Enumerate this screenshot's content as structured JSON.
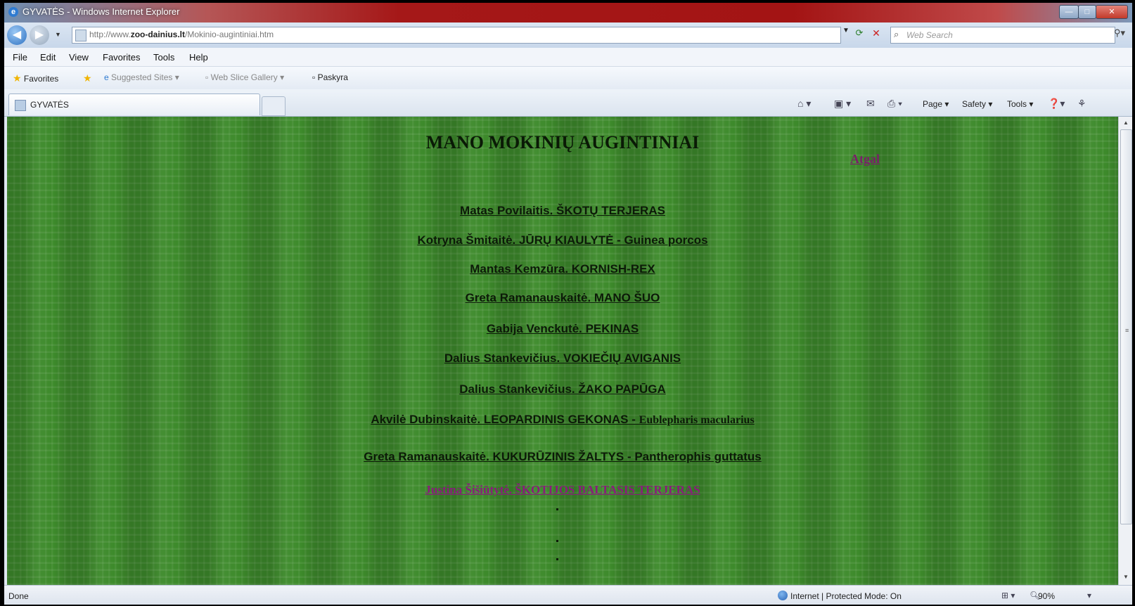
{
  "window": {
    "title": "GYVATĖS - Windows Internet Explorer",
    "minimize": "—",
    "maximize": "□",
    "close": "✕"
  },
  "address": {
    "url_prefix": "http://www.",
    "url_domain": "zoo-dainius.lt",
    "url_path": "/Mokinio-augintiniai.htm",
    "search_placeholder": "Web Search"
  },
  "menu": [
    "File",
    "Edit",
    "View",
    "Favorites",
    "Tools",
    "Help"
  ],
  "favorites": {
    "favorites_label": "Favorites",
    "suggested_sites": "Suggested Sites ▾",
    "web_slice_gallery": "Web Slice Gallery ▾",
    "paskyra": "Paskyra"
  },
  "tab": {
    "label": "GYVATĖS"
  },
  "commands": {
    "page": "Page ▾",
    "safety": "Safety ▾",
    "tools": "Tools ▾"
  },
  "content": {
    "title": "MANO MOKINIŲ AUGINTINIAI",
    "back_link": "Atgal",
    "links": [
      {
        "text": "Matas Povilaitis. ŠKOTŲ TERJERAS",
        "extra": ""
      },
      {
        "text": "Kotryna Šmitaitė. JŪRŲ KIAULYTĖ - Guinea porcos",
        "extra": ""
      },
      {
        "text": "Mantas Kemzūra. KORNISH-REX",
        "extra": ""
      },
      {
        "text": "Greta Ramanauskaitė. MANO ŠUO",
        "extra": ""
      },
      {
        "text": "Gabija Venckutė. PEKINAS",
        "extra": ""
      },
      {
        "text": "Dalius Stankevičius. VOKIEČIŲ AVIGANIS",
        "extra": ""
      },
      {
        "text": "Dalius Stankevičius. ŽAKO PAPŪGA",
        "extra": ""
      },
      {
        "text": "Akvilė Dubinskaitė. LEOPARDINIS GEKONAS - ",
        "extra": "Eublepharis macularius"
      },
      {
        "text": "Greta Ramanauskaitė. KUKURŪZINIS ŽALTYS - Pantherophis guttatus",
        "extra": ""
      },
      {
        "text": "Justina Šišiūtytė. ŠKOTIJOS BALTASIS TERJERAS",
        "extra": ""
      }
    ]
  },
  "status": {
    "text": "Done",
    "zone": "Internet | Protected Mode: On",
    "zoom": "90%"
  }
}
